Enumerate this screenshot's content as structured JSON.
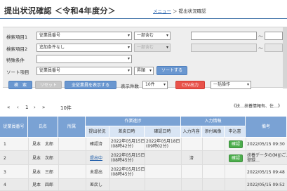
{
  "header": {
    "title": "提出状況確認 ＜令和4年度分＞",
    "crumb_link": "メニュー",
    "crumb_sep": "＞",
    "crumb_current": "提出状況確認"
  },
  "search": {
    "item1_label": "検索項目1",
    "item1_value": "従業員番号",
    "item1_match": "一部含む",
    "item2_label": "検索項目2",
    "item2_value": "追加条件なし",
    "item2_match": "一部含む",
    "tilde": "～",
    "special_label": "特殊条件",
    "sort_label": "ソート項目",
    "sort_value": "従業員番号",
    "sort_order": "昇順",
    "sort_button": "ソートする"
  },
  "toolbar": {
    "search_button": "検　索",
    "reset_button": "リセット",
    "show_all_button": "全従業員を表示する",
    "count_label": "表示件数",
    "count_value": "10件",
    "csv_button": "CSV出力",
    "batch_value": "一括操作"
  },
  "note": "《扶…扶養情報有、住…》",
  "pager": {
    "first": "«",
    "prev": "‹",
    "page": "1",
    "next": "›",
    "last": "»",
    "total": "10件"
  },
  "table": {
    "headers": {
      "emp_no": "従業員番号",
      "name": "氏名",
      "dept": "所属",
      "group_work": "作業進捗",
      "work_status": "提出状況",
      "start_date": "差戻日時",
      "confirm_date": "確認日時",
      "group_input": "入力情報",
      "input_content": "入力内容",
      "attach": "添付画像",
      "apply": "申込書",
      "note": "備考"
    },
    "rows": [
      {
        "emp_no": "1",
        "name": "見本　太郎",
        "status": "確認済",
        "start": "2022年05月15日\n(08時42分)",
        "confirm": "2022年05月18日\n(09時02分)",
        "input": "",
        "apply": "確認",
        "note": "2022/05/15 09:30"
      },
      {
        "emp_no": "2",
        "name": "見本　次郎",
        "status": "提出中",
        "start": "2022年05月15日\n(08時45分)",
        "confirm": "",
        "input": "済",
        "apply": "確認",
        "note": "扶養データの(MIJ)ご…\n登録…"
      },
      {
        "emp_no": "3",
        "name": "見本　三郎",
        "status": "未提出",
        "start": "2022年05月15日\n(08時45分)",
        "confirm": "",
        "input": "",
        "apply": "",
        "note": "2022/05/15 09:48"
      },
      {
        "emp_no": "4",
        "name": "見本　四郎",
        "status": "差戻し",
        "start": "",
        "confirm": "",
        "input": "",
        "apply": "",
        "note": "2022/05/15 09:52"
      }
    ]
  }
}
